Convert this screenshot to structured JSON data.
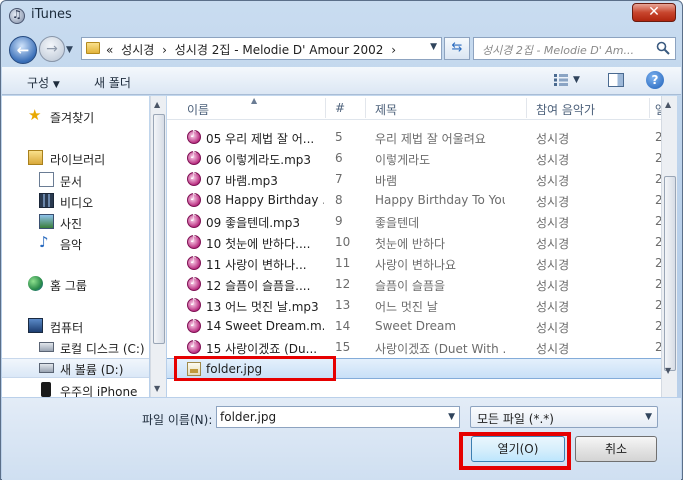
{
  "window": {
    "title": "iTunes"
  },
  "address": {
    "prefix": "«",
    "crumbs": [
      "성시경",
      "›",
      "성시경 2집 - Melodie D' Amour 2002",
      "›"
    ],
    "search_placeholder": "성시경 2집 - Melodie D' Am..."
  },
  "toolbar": {
    "organize_label": "구성",
    "new_folder_label": "새 폴더"
  },
  "sidebar": {
    "items": [
      {
        "label": "즐겨찾기",
        "icon": "star-icon"
      },
      {
        "label": "라이브러리",
        "icon": "library-icon"
      },
      {
        "label": "문서",
        "icon": "documents-icon"
      },
      {
        "label": "비디오",
        "icon": "video-icon"
      },
      {
        "label": "사진",
        "icon": "pictures-icon"
      },
      {
        "label": "음악",
        "icon": "music-icon"
      },
      {
        "label": "홈 그룹",
        "icon": "homegroup-icon"
      },
      {
        "label": "컴퓨터",
        "icon": "computer-icon"
      },
      {
        "label": "로컬 디스크 (C:)",
        "icon": "drive-icon"
      },
      {
        "label": "새 볼륨 (D:)",
        "icon": "drive-icon"
      },
      {
        "label": "우주의 iPhone",
        "icon": "phone-icon"
      }
    ]
  },
  "filelist": {
    "columns": {
      "name": "이름",
      "number": "#",
      "title": "제목",
      "artist": "참여 음악가",
      "extra": "앨"
    },
    "rows": [
      {
        "name": "05 우리 제법 잘 어...",
        "number": "5",
        "title": "우리 제법 잘 어울려요",
        "artist": "성시경",
        "extra": "2"
      },
      {
        "name": "06 이렇게라도.mp3",
        "number": "6",
        "title": "이렇게라도",
        "artist": "성시경",
        "extra": "2"
      },
      {
        "name": "07 바램.mp3",
        "number": "7",
        "title": "바램",
        "artist": "성시경",
        "extra": "2"
      },
      {
        "name": "08 Happy Birthday ...",
        "number": "8",
        "title": "Happy Birthday To You",
        "artist": "성시경",
        "extra": "2"
      },
      {
        "name": "09 좋을텐데.mp3",
        "number": "9",
        "title": "좋을텐데",
        "artist": "성시경",
        "extra": "2"
      },
      {
        "name": "10 첫눈에 반하다....",
        "number": "10",
        "title": "첫눈에 반하다",
        "artist": "성시경",
        "extra": "2"
      },
      {
        "name": "11 사랑이 변하나...",
        "number": "11",
        "title": "사랑이 변하나요",
        "artist": "성시경",
        "extra": "2"
      },
      {
        "name": "12 슬픔이 슬픔을....",
        "number": "12",
        "title": "슬픔이 슬픔을",
        "artist": "성시경",
        "extra": "2"
      },
      {
        "name": "13 어느 멋진 날.mp3",
        "number": "13",
        "title": "어느 멋진 날",
        "artist": "성시경",
        "extra": "2"
      },
      {
        "name": "14 Sweet Dream.m...",
        "number": "14",
        "title": "Sweet Dream",
        "artist": "성시경",
        "extra": "2"
      },
      {
        "name": "15 사랑이겠죠 (Du...",
        "number": "15",
        "title": "사랑이겠죠 (Duet With ...",
        "artist": "성시경",
        "extra": "2"
      }
    ],
    "selected_file": "folder.jpg"
  },
  "bottom": {
    "filename_label": "파일 이름(N):",
    "filename_value": "folder.jpg",
    "filetype_value": "모든 파일 (*.*)",
    "open_label": "열기(O)",
    "cancel_label": "취소"
  },
  "colors": {
    "highlight": "#e60000",
    "selection": "#c9e0f7",
    "accent": "#3c7fb1"
  }
}
